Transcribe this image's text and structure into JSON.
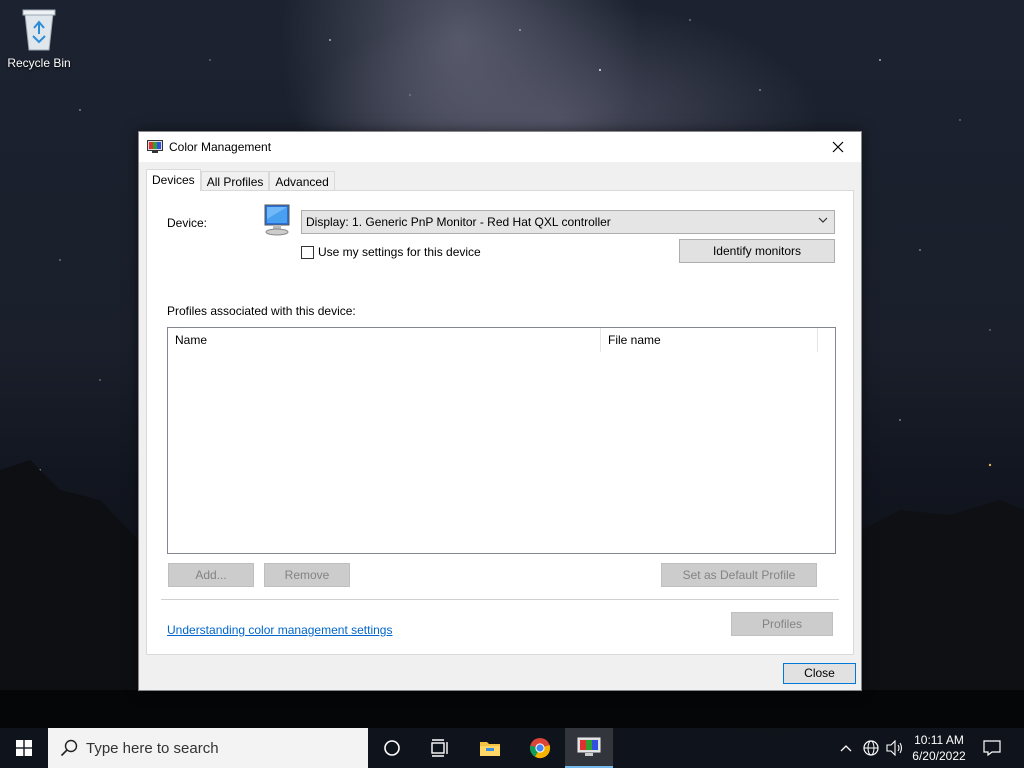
{
  "desktop": {
    "recycle_bin_label": "Recycle Bin"
  },
  "window": {
    "title": "Color Management",
    "tabs": [
      {
        "label": "Devices",
        "active": true
      },
      {
        "label": "All Profiles",
        "active": false
      },
      {
        "label": "Advanced",
        "active": false
      }
    ],
    "devices": {
      "device_label": "Device:",
      "device_value": "Display: 1. Generic PnP Monitor - Red Hat QXL controller",
      "use_settings_label": "Use my settings for this device",
      "use_settings_checked": false,
      "identify_label": "Identify monitors",
      "profiles_label": "Profiles associated with this device:",
      "columns": [
        "Name",
        "File name"
      ],
      "rows": [],
      "add_label": "Add...",
      "remove_label": "Remove",
      "set_default_label": "Set as Default Profile",
      "help_link": "Understanding color management settings",
      "profiles_button": "Profiles"
    },
    "close_label": "Close"
  },
  "taskbar": {
    "search_placeholder": "Type here to search",
    "time": "10:11 AM",
    "date": "6/20/2022",
    "accent": "#0078d7"
  }
}
